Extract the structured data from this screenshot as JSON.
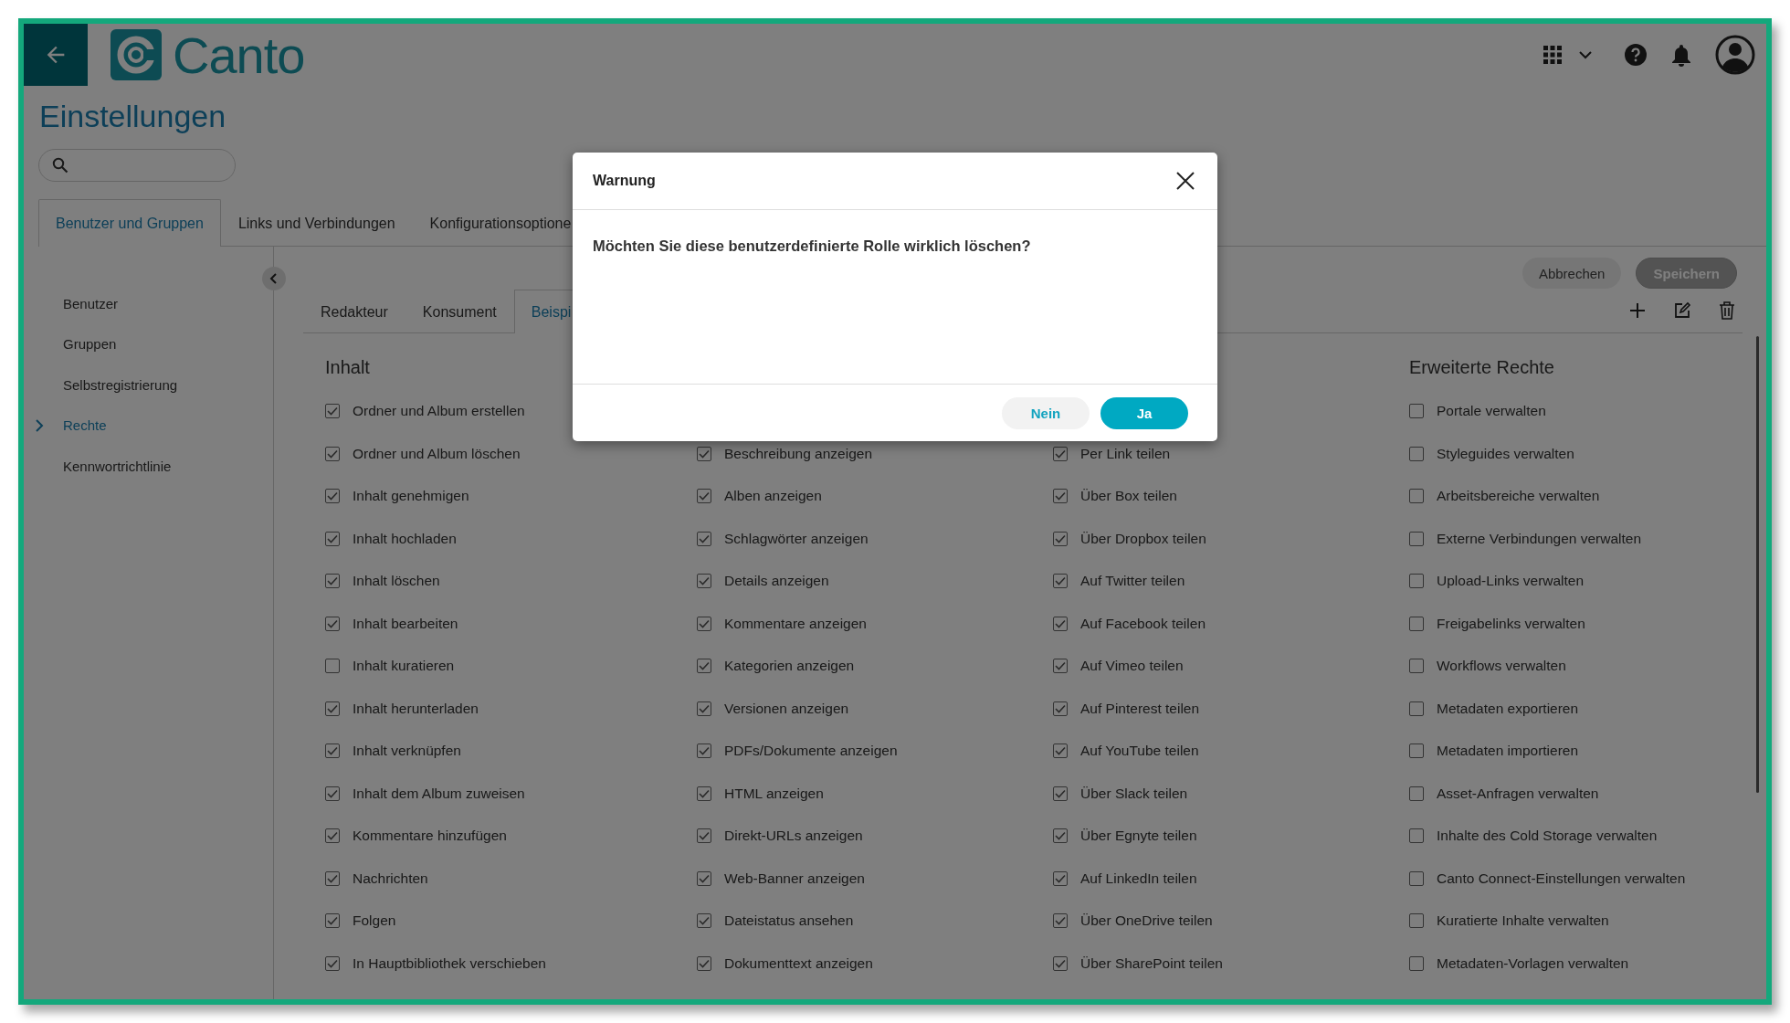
{
  "header": {
    "logo_text": "Canto"
  },
  "page_title": "Einstellungen",
  "main_tabs": [
    {
      "label": "Benutzer und Gruppen",
      "selected": true
    },
    {
      "label": "Links und Verbindungen",
      "selected": false
    },
    {
      "label": "Konfigurationsoptione",
      "selected": false
    }
  ],
  "sidebar": {
    "items": [
      {
        "label": "Benutzer",
        "selected": false
      },
      {
        "label": "Gruppen",
        "selected": false
      },
      {
        "label": "Selbstregistrierung",
        "selected": false
      },
      {
        "label": "Rechte",
        "selected": true
      },
      {
        "label": "Kennwortrichtlinie",
        "selected": false
      }
    ]
  },
  "actions": [
    {
      "label": "Abbrechen",
      "disabled": false
    },
    {
      "label": "Speichern",
      "disabled": true
    }
  ],
  "role_tabs": [
    {
      "label": "Redakteur",
      "selected": false
    },
    {
      "label": "Konsument",
      "selected": false
    },
    {
      "label": "Beispi",
      "selected": true
    }
  ],
  "columns": [
    {
      "heading": "Inhalt",
      "items": [
        {
          "label": "Ordner und Album erstellen",
          "checked": true
        },
        {
          "label": "Ordner und Album löschen",
          "checked": true
        },
        {
          "label": "Inhalt genehmigen",
          "checked": true
        },
        {
          "label": "Inhalt hochladen",
          "checked": true
        },
        {
          "label": "Inhalt löschen",
          "checked": true
        },
        {
          "label": "Inhalt bearbeiten",
          "checked": true
        },
        {
          "label": "Inhalt kuratieren",
          "checked": false
        },
        {
          "label": "Inhalt herunterladen",
          "checked": true
        },
        {
          "label": "Inhalt verknüpfen",
          "checked": true
        },
        {
          "label": "Inhalt dem Album zuweisen",
          "checked": true
        },
        {
          "label": "Kommentare hinzufügen",
          "checked": true
        },
        {
          "label": "Nachrichten",
          "checked": true
        },
        {
          "label": "Folgen",
          "checked": true
        },
        {
          "label": "In Hauptbibliothek verschieben",
          "checked": true
        }
      ]
    },
    {
      "items": [
        {
          "label": "Beschreibung anzeigen",
          "checked": true
        },
        {
          "label": "Alben anzeigen",
          "checked": true
        },
        {
          "label": "Schlagwörter anzeigen",
          "checked": true
        },
        {
          "label": "Details anzeigen",
          "checked": true
        },
        {
          "label": "Kommentare anzeigen",
          "checked": true
        },
        {
          "label": "Kategorien anzeigen",
          "checked": true
        },
        {
          "label": "Versionen anzeigen",
          "checked": true
        },
        {
          "label": "PDFs/Dokumente anzeigen",
          "checked": true
        },
        {
          "label": "HTML anzeigen",
          "checked": true
        },
        {
          "label": "Direkt-URLs anzeigen",
          "checked": true
        },
        {
          "label": "Web-Banner anzeigen",
          "checked": true
        },
        {
          "label": "Dateistatus ansehen",
          "checked": true
        },
        {
          "label": "Dokumenttext anzeigen",
          "checked": true
        }
      ]
    },
    {
      "items": [
        {
          "label": "Per Link teilen",
          "checked": true
        },
        {
          "label": "Über Box teilen",
          "checked": true
        },
        {
          "label": "Über Dropbox teilen",
          "checked": true
        },
        {
          "label": "Auf Twitter teilen",
          "checked": true
        },
        {
          "label": "Auf Facebook teilen",
          "checked": true
        },
        {
          "label": "Auf Vimeo teilen",
          "checked": true
        },
        {
          "label": "Auf Pinterest teilen",
          "checked": true
        },
        {
          "label": "Auf YouTube teilen",
          "checked": true
        },
        {
          "label": "Über Slack teilen",
          "checked": true
        },
        {
          "label": "Über Egnyte teilen",
          "checked": true
        },
        {
          "label": "Auf LinkedIn teilen",
          "checked": true
        },
        {
          "label": "Über OneDrive teilen",
          "checked": true
        },
        {
          "label": "Über SharePoint teilen",
          "checked": true
        }
      ]
    },
    {
      "heading": "Erweiterte Rechte",
      "items": [
        {
          "label": "Portale verwalten",
          "checked": false
        },
        {
          "label": "Styleguides verwalten",
          "checked": false
        },
        {
          "label": "Arbeitsbereiche verwalten",
          "checked": false
        },
        {
          "label": "Externe Verbindungen verwalten",
          "checked": false
        },
        {
          "label": "Upload-Links verwalten",
          "checked": false
        },
        {
          "label": "Freigabelinks verwalten",
          "checked": false
        },
        {
          "label": "Workflows verwalten",
          "checked": false
        },
        {
          "label": "Metadaten exportieren",
          "checked": false
        },
        {
          "label": "Metadaten importieren",
          "checked": false
        },
        {
          "label": "Asset-Anfragen verwalten",
          "checked": false
        },
        {
          "label": "Inhalte des Cold Storage verwalten",
          "checked": false
        },
        {
          "label": "Canto Connect-Einstellungen verwalten",
          "checked": false
        },
        {
          "label": "Kuratierte Inhalte verwalten",
          "checked": false
        },
        {
          "label": "Metadaten-Vorlagen verwalten",
          "checked": false
        }
      ]
    }
  ],
  "dialog": {
    "title": "Warnung",
    "message": "Möchten Sie diese benutzerdefinierte Rolle wirklich löschen?",
    "buttons": [
      {
        "label": "Nein",
        "kind": "secondary"
      },
      {
        "label": "Ja",
        "kind": "primary"
      }
    ]
  }
}
